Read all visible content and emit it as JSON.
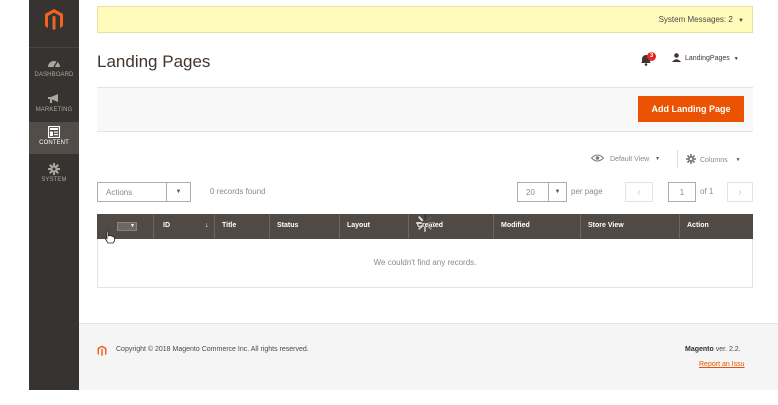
{
  "nav": {
    "items": [
      {
        "label": "DASHBOARD",
        "icon": "dashboard-icon"
      },
      {
        "label": "MARKETING",
        "icon": "megaphone-icon"
      },
      {
        "label": "CONTENT",
        "icon": "content-icon"
      },
      {
        "label": "SYSTEM",
        "icon": "gear-icon"
      }
    ]
  },
  "system_messages": {
    "label": "System Messages: 2"
  },
  "header": {
    "title": "Landing Pages",
    "notification_count": "3",
    "user": "LandingPages"
  },
  "primary_action": {
    "label": "Add Landing Page"
  },
  "grid_controls": {
    "view_label": "Default View",
    "columns_label": "Columns"
  },
  "toolbar": {
    "actions_label": "Actions",
    "records_found": "0 records found",
    "per_page_value": "20",
    "per_page_label": "per page",
    "page_value": "1",
    "page_of": "of 1"
  },
  "grid": {
    "columns": [
      "ID",
      "Title",
      "Status",
      "Layout",
      "Created",
      "Modified",
      "Store View",
      "Action"
    ],
    "sort_marker": "↓",
    "empty_message": "We couldn't find any records."
  },
  "footer": {
    "copyright": "Copyright © 2018 Magento Commerce Inc. All rights reserved.",
    "brand": "Magento",
    "version": " ver. 2.2.",
    "report_link": "Report an Issu"
  },
  "colors": {
    "accent": "#eb5202",
    "nav_bg": "#373330",
    "grid_header": "#514943",
    "notice_bg": "#fffbbb"
  }
}
